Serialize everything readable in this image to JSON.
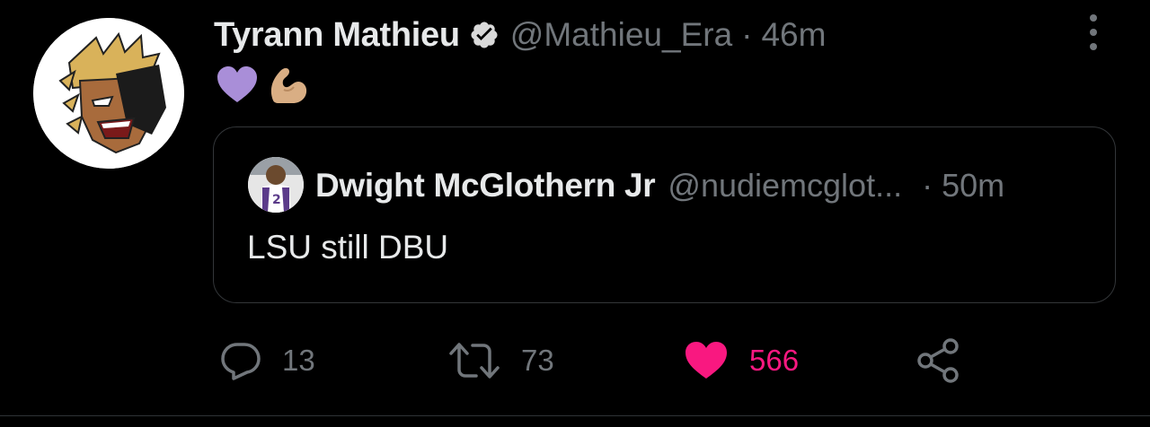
{
  "tweet": {
    "author_name": "Tyrann Mathieu",
    "author_handle": "@Mathieu_Era",
    "separator": "·",
    "time": "46m",
    "verified": true,
    "body_emojis": [
      "purple-heart-emoji",
      "flexed-biceps-emoji"
    ]
  },
  "quoted": {
    "author_name": "Dwight McGlothern Jr",
    "author_handle": "@nudiemcglot...",
    "separator": "·",
    "time": "50m",
    "text": "LSU still DBU"
  },
  "actions": {
    "reply_count": "13",
    "retweet_count": "73",
    "like_count": "566",
    "liked": true
  },
  "colors": {
    "background": "#000000",
    "primary_text": "#e7e9ea",
    "secondary_text": "#71767b",
    "like_pink": "#f91880",
    "border": "#333639"
  }
}
